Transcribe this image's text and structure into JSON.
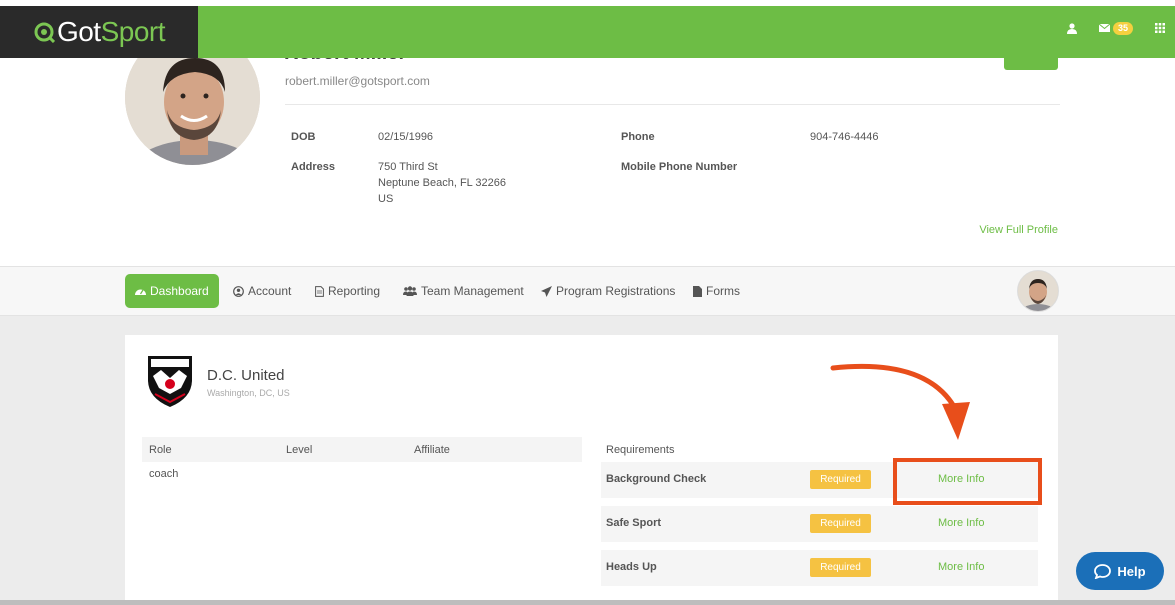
{
  "brand": {
    "part1": "Got",
    "part2": "Sport"
  },
  "topbar": {
    "mail_count": "35"
  },
  "profile": {
    "name": "Robert Miller",
    "email": "robert.miller@gotsport.com",
    "dob_label": "DOB",
    "dob": "02/15/1996",
    "address_label": "Address",
    "address_line1": "750 Third St",
    "address_line2": "Neptune Beach, FL 32266",
    "address_line3": "US",
    "phone_label": "Phone",
    "phone": "904-746-4446",
    "mobile_label": "Mobile Phone Number",
    "view_full": "View Full Profile"
  },
  "nav": {
    "items": [
      {
        "label": "Dashboard",
        "icon": "dashboard-icon"
      },
      {
        "label": "Account",
        "icon": "user-circle-icon"
      },
      {
        "label": "Reporting",
        "icon": "document-icon"
      },
      {
        "label": "Team Management",
        "icon": "users-icon"
      },
      {
        "label": "Program Registrations",
        "icon": "paper-plane-icon"
      },
      {
        "label": "Forms",
        "icon": "file-icon"
      }
    ]
  },
  "team": {
    "name": "D.C. United",
    "location": "Washington, DC, US"
  },
  "roles": {
    "headers": [
      "Role",
      "Level",
      "Affiliate"
    ],
    "rows": [
      {
        "role": "coach",
        "level": "",
        "affiliate": ""
      }
    ]
  },
  "requirements": {
    "header": "Requirements",
    "rows": [
      {
        "name": "Background Check",
        "status": "Required",
        "link": "More Info"
      },
      {
        "name": "Safe Sport",
        "status": "Required",
        "link": "More Info"
      },
      {
        "name": "Heads Up",
        "status": "Required",
        "link": "More Info"
      }
    ]
  },
  "help": {
    "label": "Help"
  },
  "colors": {
    "brand_green": "#6dbd45",
    "badge_yellow": "#f5c242",
    "annotation_orange": "#e84e1b",
    "help_blue": "#1b6fb8"
  }
}
